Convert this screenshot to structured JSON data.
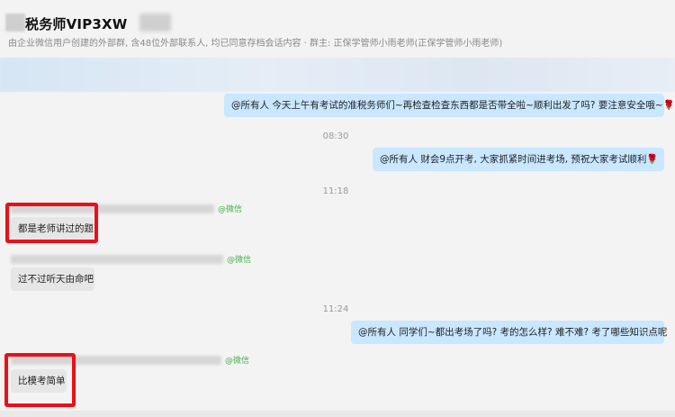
{
  "header": {
    "title": "税务师VIP3XW",
    "subtitle": "由企业微信用户创建的外部群, 含48位外部联系人, 均已同意存档会话内容 · 群主: 正保学管师小雨老师(正保学管师小雨老师)"
  },
  "messages": [
    {
      "side": "right",
      "text": "@所有人 今天上午有考试的准税务师们~再检查检查东西都是否带全啦~顺利出发了吗? 要注意安全哦~",
      "emoji": "🌹"
    },
    {
      "time": "08:30"
    },
    {
      "side": "right",
      "text": "@所有人 财会9点开考, 大家抓紧时间进考场, 预祝大家考试顺利",
      "emoji": "🌹"
    },
    {
      "time": "11:18"
    },
    {
      "side": "left",
      "sender_tag": "@微信",
      "text": "都是老师讲过的题"
    },
    {
      "side": "left",
      "sender_tag": "@微信",
      "text": "过不过听天由命吧"
    },
    {
      "time": "11:24"
    },
    {
      "side": "right",
      "text": "@所有人 同学们~都出考场了吗? 考的怎么样? 难不难? 考了哪些知识点呢"
    },
    {
      "side": "left",
      "sender_tag": "@微信",
      "text": "比模考简单"
    }
  ],
  "colors": {
    "right_bubble": "#c9e7ff",
    "left_bubble": "#e6e6e6",
    "highlight": "#e8101a",
    "wechat_tag": "#4caf50"
  }
}
